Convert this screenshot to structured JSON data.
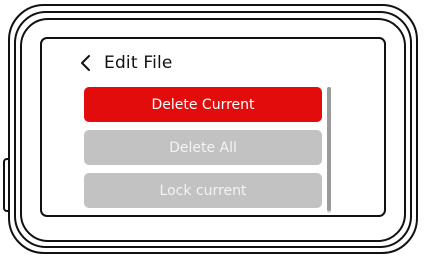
{
  "header": {
    "back_icon": "chevron-left-icon",
    "title": "Edit File"
  },
  "menu": {
    "items": [
      {
        "label": "Delete Current",
        "state": "selected"
      },
      {
        "label": "Delete All",
        "state": "normal"
      },
      {
        "label": "Lock current",
        "state": "normal"
      },
      {
        "label": "",
        "state": "normal"
      }
    ]
  },
  "colors": {
    "accent": "#e30c0c",
    "item_bg": "#c2c2c2",
    "frame": "#111111"
  }
}
